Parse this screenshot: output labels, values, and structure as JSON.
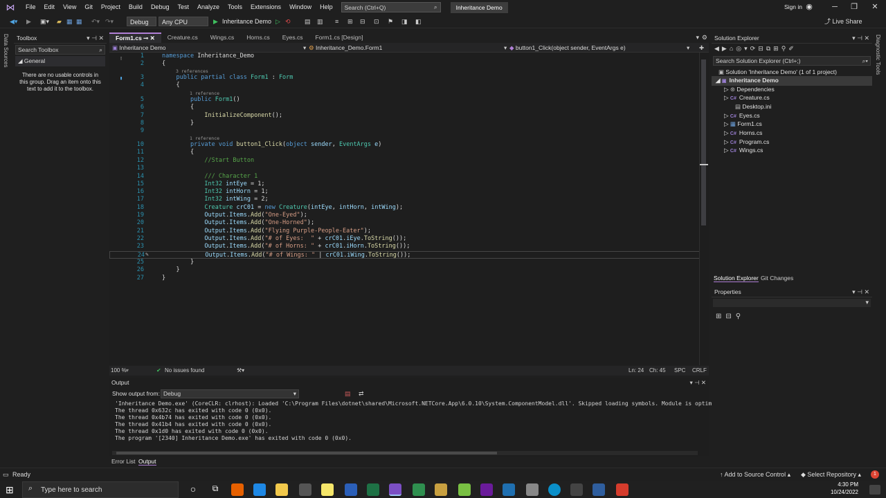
{
  "menubar": {
    "items": [
      "File",
      "Edit",
      "View",
      "Git",
      "Project",
      "Build",
      "Debug",
      "Test",
      "Analyze",
      "Tools",
      "Extensions",
      "Window",
      "Help"
    ],
    "search_placeholder": "Search (Ctrl+Q)",
    "solution_name": "Inheritance Demo",
    "signin": "Sign in"
  },
  "toolbar": {
    "config": "Debug",
    "platform": "Any CPU",
    "run_label": "Inheritance Demo",
    "live_share": "Live Share"
  },
  "leftstrip": {
    "label": "Data Sources"
  },
  "rightstrip": {
    "label": "Diagnostic Tools"
  },
  "toolbox": {
    "title": "Toolbox",
    "search": "Search Toolbox",
    "group": "General",
    "empty_text": "There are no usable controls in this group. Drag an item onto this text to add it to the toolbox."
  },
  "editor": {
    "tabs": [
      {
        "label": "Form1.cs"
      },
      {
        "label": "Creature.cs"
      },
      {
        "label": "Wings.cs"
      },
      {
        "label": "Horns.cs"
      },
      {
        "label": "Eyes.cs"
      },
      {
        "label": "Form1.cs [Design]"
      }
    ],
    "nav_project": "Inheritance Demo",
    "nav_class": "Inheritance_Demo.Form1",
    "nav_member": "button1_Click(object sender, EventArgs e)",
    "zoom": "100 %",
    "issues": "No issues found",
    "ln": "Ln: 24",
    "ch": "Ch: 45",
    "spc": "SPC",
    "crlf": "CRLF",
    "refs": {
      "r3": "3 references",
      "r1a": "1 reference",
      "r1b": "1 reference"
    }
  },
  "output": {
    "title": "Output",
    "show_from_label": "Show output from:",
    "source": "Debug",
    "lines": [
      "'Inheritance Demo.exe' (CoreCLR: clrhost): Loaded 'C:\\Program Files\\dotnet\\shared\\Microsoft.NETCore.App\\6.0.10\\System.ComponentModel.dll'. Skipped loading symbols. Module is optimiz",
      "The thread 0x632c has exited with code 0 (0x0).",
      "The thread 0x4b74 has exited with code 0 (0x0).",
      "The thread 0x41b4 has exited with code 0 (0x0).",
      "The thread 0x1d0 has exited with code 0 (0x0).",
      "The program '[2340] Inheritance Demo.exe' has exited with code 0 (0x0)."
    ],
    "tab_errorlist": "Error List",
    "tab_output": "Output"
  },
  "solution_explorer": {
    "title": "Solution Explorer",
    "search": "Search Solution Explorer (Ctrl+;)",
    "solution": "Solution 'Inheritance Demo' (1 of 1 project)",
    "project": "Inheritance Demo",
    "items": [
      "Dependencies",
      "Creature.cs",
      "Desktop.ini",
      "Eyes.cs",
      "Form1.cs",
      "Horns.cs",
      "Program.cs",
      "Wings.cs"
    ],
    "tab_se": "Solution Explorer",
    "tab_git": "Git Changes"
  },
  "properties": {
    "title": "Properties"
  },
  "statusbar": {
    "ready": "Ready",
    "source_control": "Add to Source Control",
    "repo": "Select Repository"
  },
  "taskbar": {
    "search": "Type here to search",
    "time": "4:30 PM",
    "date": "10/24/2022"
  }
}
